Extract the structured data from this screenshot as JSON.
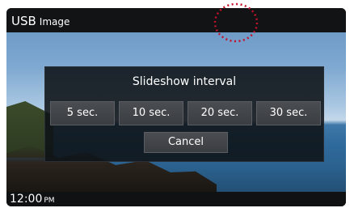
{
  "window": {
    "title_main": "USB",
    "title_sub": "Image"
  },
  "dialog": {
    "title": "Slideshow interval",
    "options": [
      "5 sec.",
      "10 sec.",
      "20 sec.",
      "30 sec."
    ],
    "cancel_label": "Cancel"
  },
  "status": {
    "time": "12:00",
    "ampm": "PM"
  },
  "colors": {
    "frame_bg": "#101214",
    "dialog_bg": "#0e1216",
    "button_bg": "#3f4246",
    "highlight_circle": "#c4122a"
  }
}
